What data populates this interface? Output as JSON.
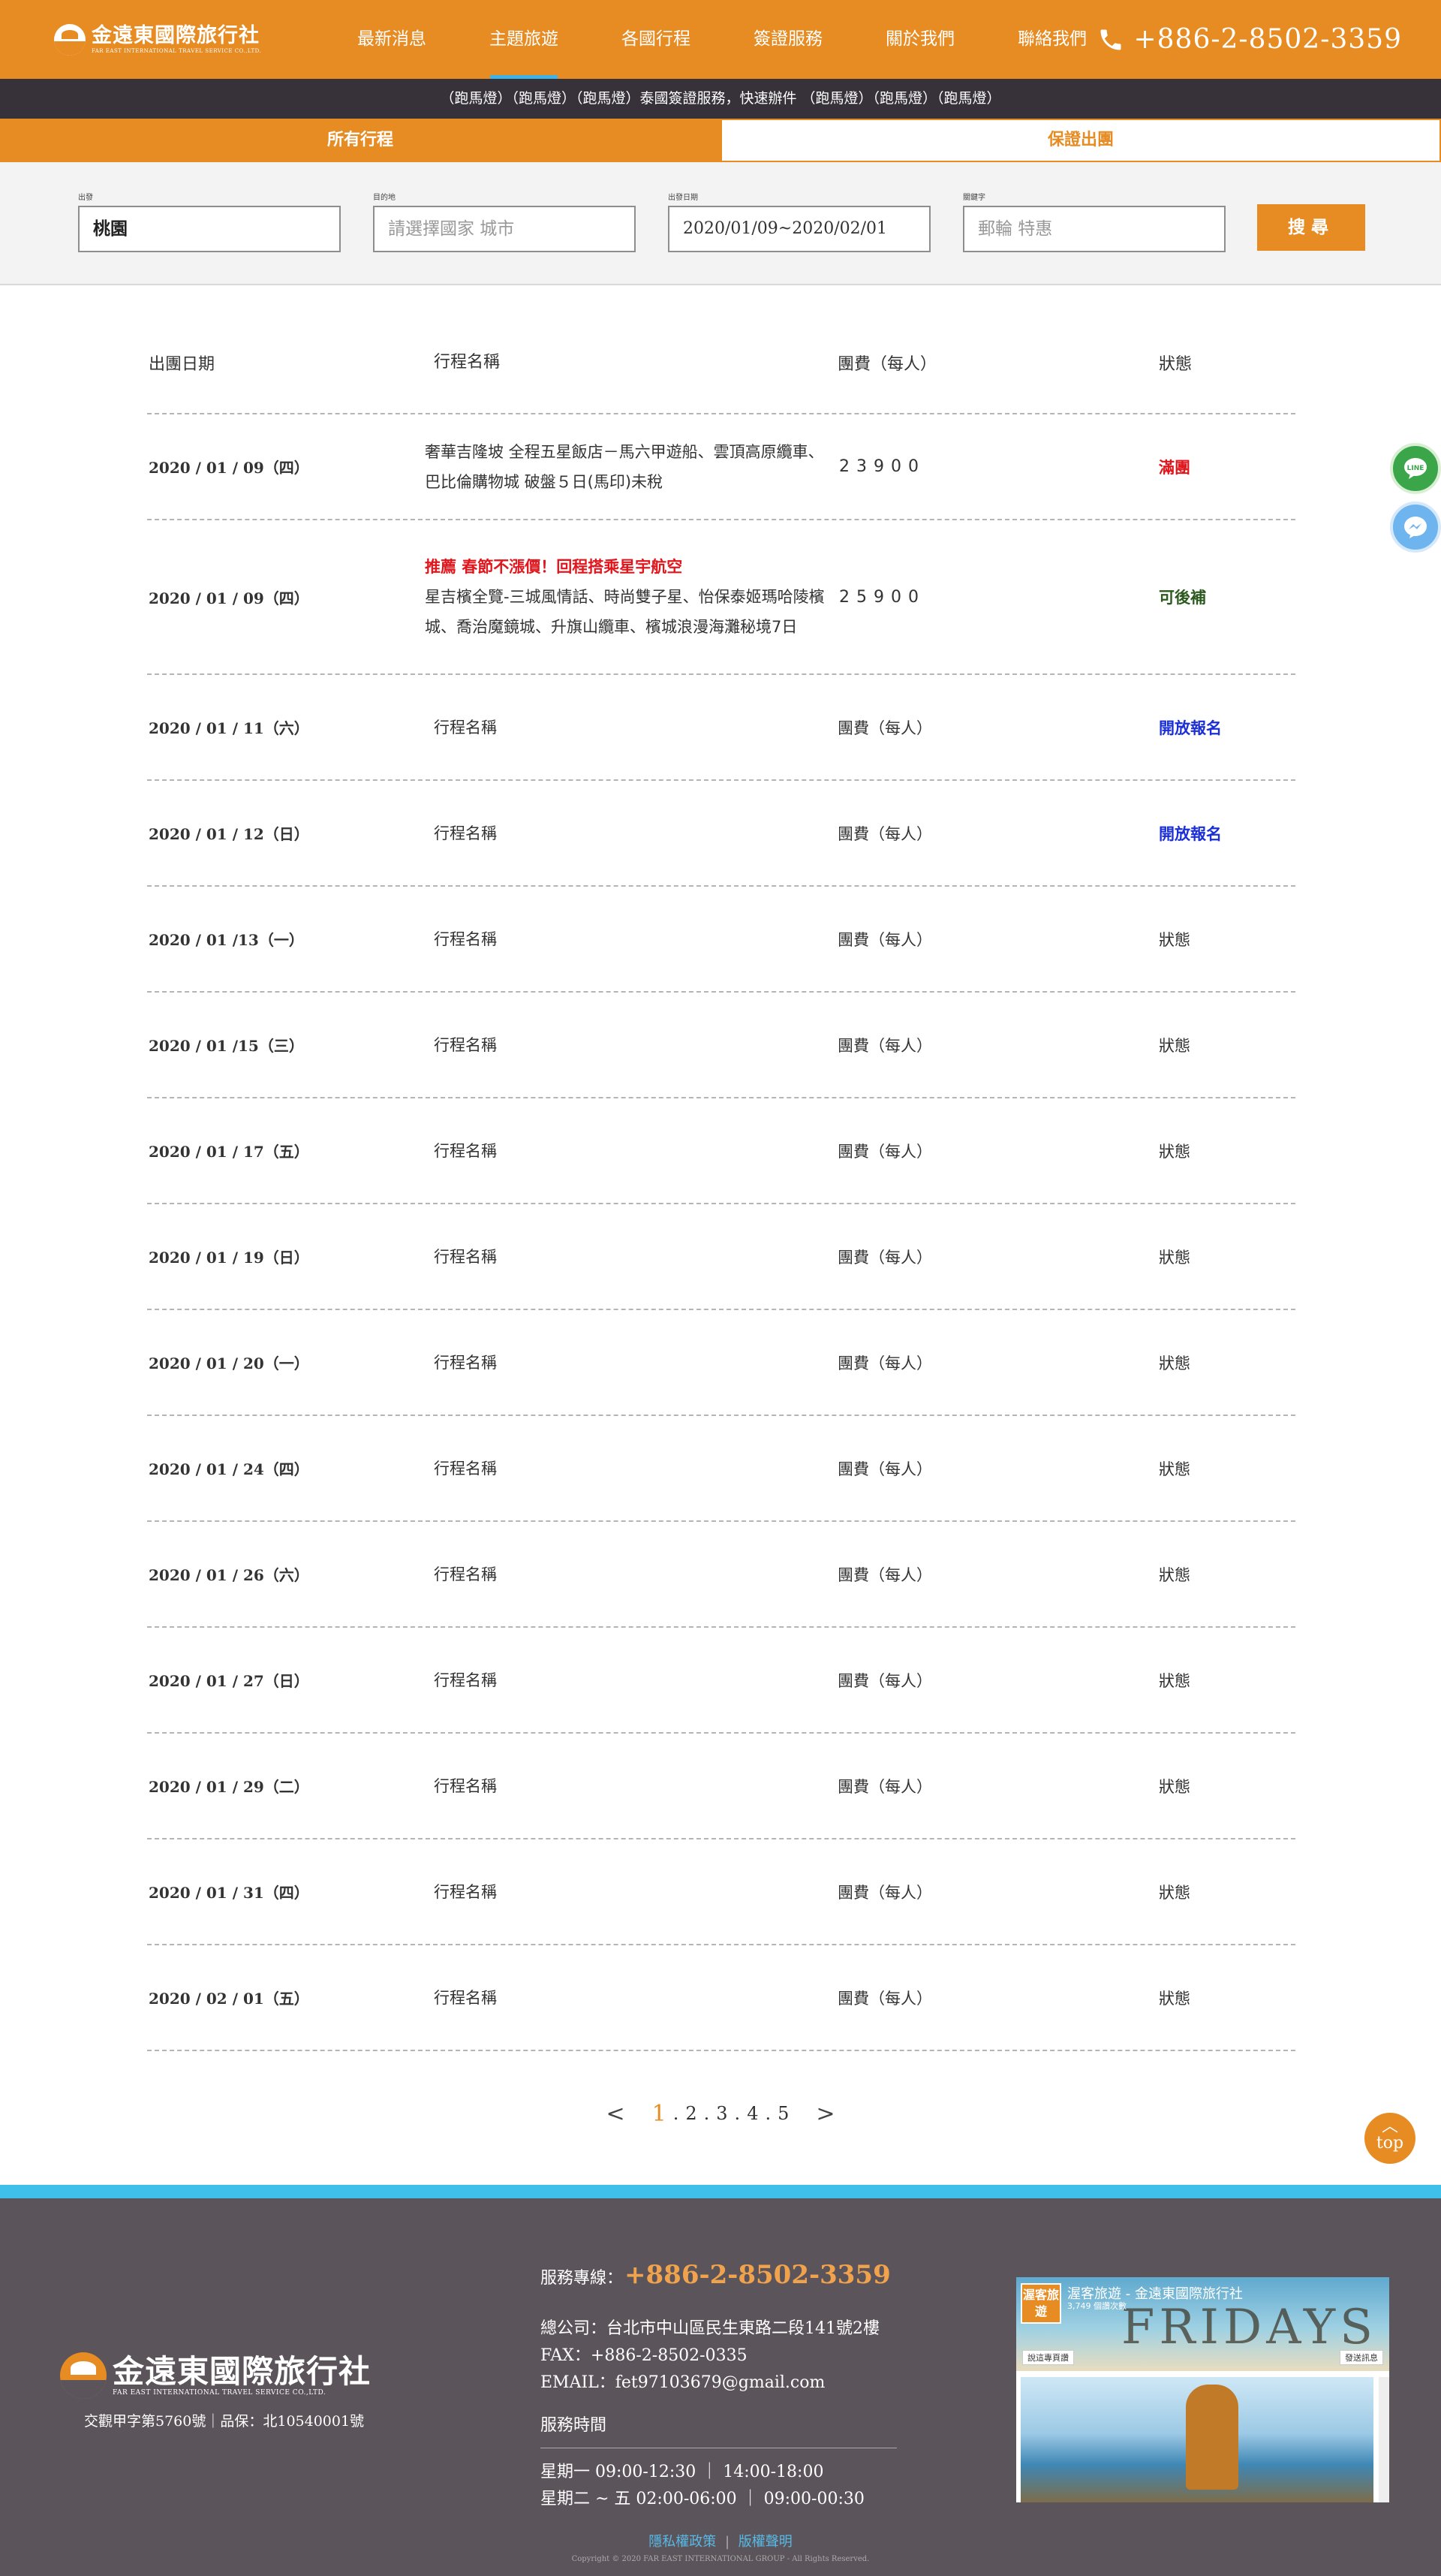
{
  "header": {
    "logo_cn": "金遠東國際旅行社",
    "logo_en": "FAR EAST INTERNATIONAL TRAVEL SERVICE CO.,LTD.",
    "nav": [
      "最新消息",
      "主題旅遊",
      "各國行程",
      "簽證服務",
      "關於我們",
      "聯絡我們"
    ],
    "active_nav": "主題旅遊",
    "phone": "+886-2-8502-3359",
    "phone_icon": "phone-icon"
  },
  "marquee": "（跑馬燈）（跑馬燈）（跑馬燈）泰國簽證服務，快速辦件 （跑馬燈）（跑馬燈）（跑馬燈）",
  "tabs": [
    "所有行程",
    "保證出團"
  ],
  "search": {
    "from_label": "出發",
    "from_value": "桃園",
    "dest_label": "目的地",
    "dest_placeholder": "請選擇國家 城市",
    "date_label": "出發日期",
    "date_value": "2020/01/09~2020/02/01",
    "keyword_label": "關鍵字",
    "keyword_placeholder": "郵輪 特惠",
    "button": "搜尋"
  },
  "table": {
    "headers": [
      "出團日期",
      "行程名稱",
      "團費（每人）",
      "狀態"
    ],
    "rows": [
      {
        "date": "2020 / 01 / 09（四）",
        "promo": "",
        "name": "奢華吉隆坡 全程五星飯店－馬六甲遊船、雲頂高原纜車、巴比倫購物城 破盤５日(馬印)未稅",
        "price": "23900",
        "status": "滿團",
        "status_type": "full"
      },
      {
        "date": "2020 / 01 / 09（四）",
        "promo": "推薦 春節不漲價！回程搭乘星宇航空",
        "name": "星吉檳全覽-三城風情話、時尚雙子星、怡保泰姬瑪哈陵檳城、喬治魔鏡城、升旗山纜車、檳城浪漫海灘秘境7日",
        "price": "25900",
        "status": "可後補",
        "status_type": "wait"
      },
      {
        "date": "2020 / 01 / 11（六）",
        "promo": "",
        "name": "行程名稱",
        "price": "團費（每人）",
        "status": "開放報名",
        "status_type": "open"
      },
      {
        "date": "2020 / 01 / 12（日）",
        "promo": "",
        "name": "行程名稱",
        "price": "團費（每人）",
        "status": "開放報名",
        "status_type": "open"
      },
      {
        "date": "2020 / 01 /13（一）",
        "promo": "",
        "name": "行程名稱",
        "price": "團費（每人）",
        "status": "狀態",
        "status_type": "plain"
      },
      {
        "date": "2020 / 01 /15（三）",
        "promo": "",
        "name": "行程名稱",
        "price": "團費（每人）",
        "status": "狀態",
        "status_type": "plain"
      },
      {
        "date": "2020 / 01 / 17（五）",
        "promo": "",
        "name": "行程名稱",
        "price": "團費（每人）",
        "status": "狀態",
        "status_type": "plain"
      },
      {
        "date": "2020 / 01 / 19（日）",
        "promo": "",
        "name": "行程名稱",
        "price": "團費（每人）",
        "status": "狀態",
        "status_type": "plain"
      },
      {
        "date": "2020 / 01 / 20（一）",
        "promo": "",
        "name": "行程名稱",
        "price": "團費（每人）",
        "status": "狀態",
        "status_type": "plain"
      },
      {
        "date": "2020 / 01 / 24（四）",
        "promo": "",
        "name": "行程名稱",
        "price": "團費（每人）",
        "status": "狀態",
        "status_type": "plain"
      },
      {
        "date": "2020 / 01 / 26（六）",
        "promo": "",
        "name": "行程名稱",
        "price": "團費（每人）",
        "status": "狀態",
        "status_type": "plain"
      },
      {
        "date": "2020 / 01 / 27（日）",
        "promo": "",
        "name": "行程名稱",
        "price": "團費（每人）",
        "status": "狀態",
        "status_type": "plain"
      },
      {
        "date": "2020 / 01 / 29（二）",
        "promo": "",
        "name": "行程名稱",
        "price": "團費（每人）",
        "status": "狀態",
        "status_type": "plain"
      },
      {
        "date": "2020 / 01 / 31（四）",
        "promo": "",
        "name": "行程名稱",
        "price": "團費（每人）",
        "status": "狀態",
        "status_type": "plain"
      },
      {
        "date": "2020 / 02 / 01（五）",
        "promo": "",
        "name": "行程名稱",
        "price": "團費（每人）",
        "status": "狀態",
        "status_type": "plain"
      }
    ]
  },
  "pagination": {
    "prev": "<",
    "pages": [
      "1",
      "2",
      "3",
      "4",
      "5"
    ],
    "current": "1",
    "next": ">"
  },
  "floats": {
    "line_icon": "line-icon",
    "messenger_icon": "messenger-icon",
    "top_label": "top"
  },
  "footer": {
    "logo_cn": "金遠東國際旅行社",
    "logo_en": "FAR EAST INTERNATIONAL TRAVEL SERVICE CO.,LTD.",
    "license": "交觀甲字第5760號｜品保：北10540001號",
    "hotline_label": "服務專線：",
    "hotline": "+886-2-8502-3359",
    "address": "總公司：台北市中山區民生東路二段141號2樓",
    "fax": "FAX：+886-2-8502-0335",
    "email": "EMAIL：fet97103679@gmail.com",
    "hours_title": "服務時間",
    "hours_1": "星期一  09:00-12:30 ｜ 14:00-18:00",
    "hours_2": "星期二 ~ 五  02:00-06:00 ｜ 09:00-00:30",
    "privacy": "隱私權政策",
    "copyright_link": "版權聲明",
    "copyright": "Copyright © 2020 FAR EAST INTERNATIONAL GROUP - All Rights Reserved."
  },
  "fb_widget": {
    "title": "渥客旅遊 - 金遠東國際旅行社",
    "likes": "3,749 個讚次數",
    "avatar_text": "渥客旅遊",
    "cover_word": "FRIDAYS",
    "like_button": "說這專頁讚",
    "share_button": "發送訊息"
  },
  "colors": {
    "brand_orange": "#e78b23",
    "dark_bar": "#37313a",
    "footer_bg": "#5c545b",
    "accent_blue": "#3fc0ea",
    "status_full": "#e0161c",
    "status_wait": "#2c5a1e",
    "status_open": "#1b2fd6"
  }
}
